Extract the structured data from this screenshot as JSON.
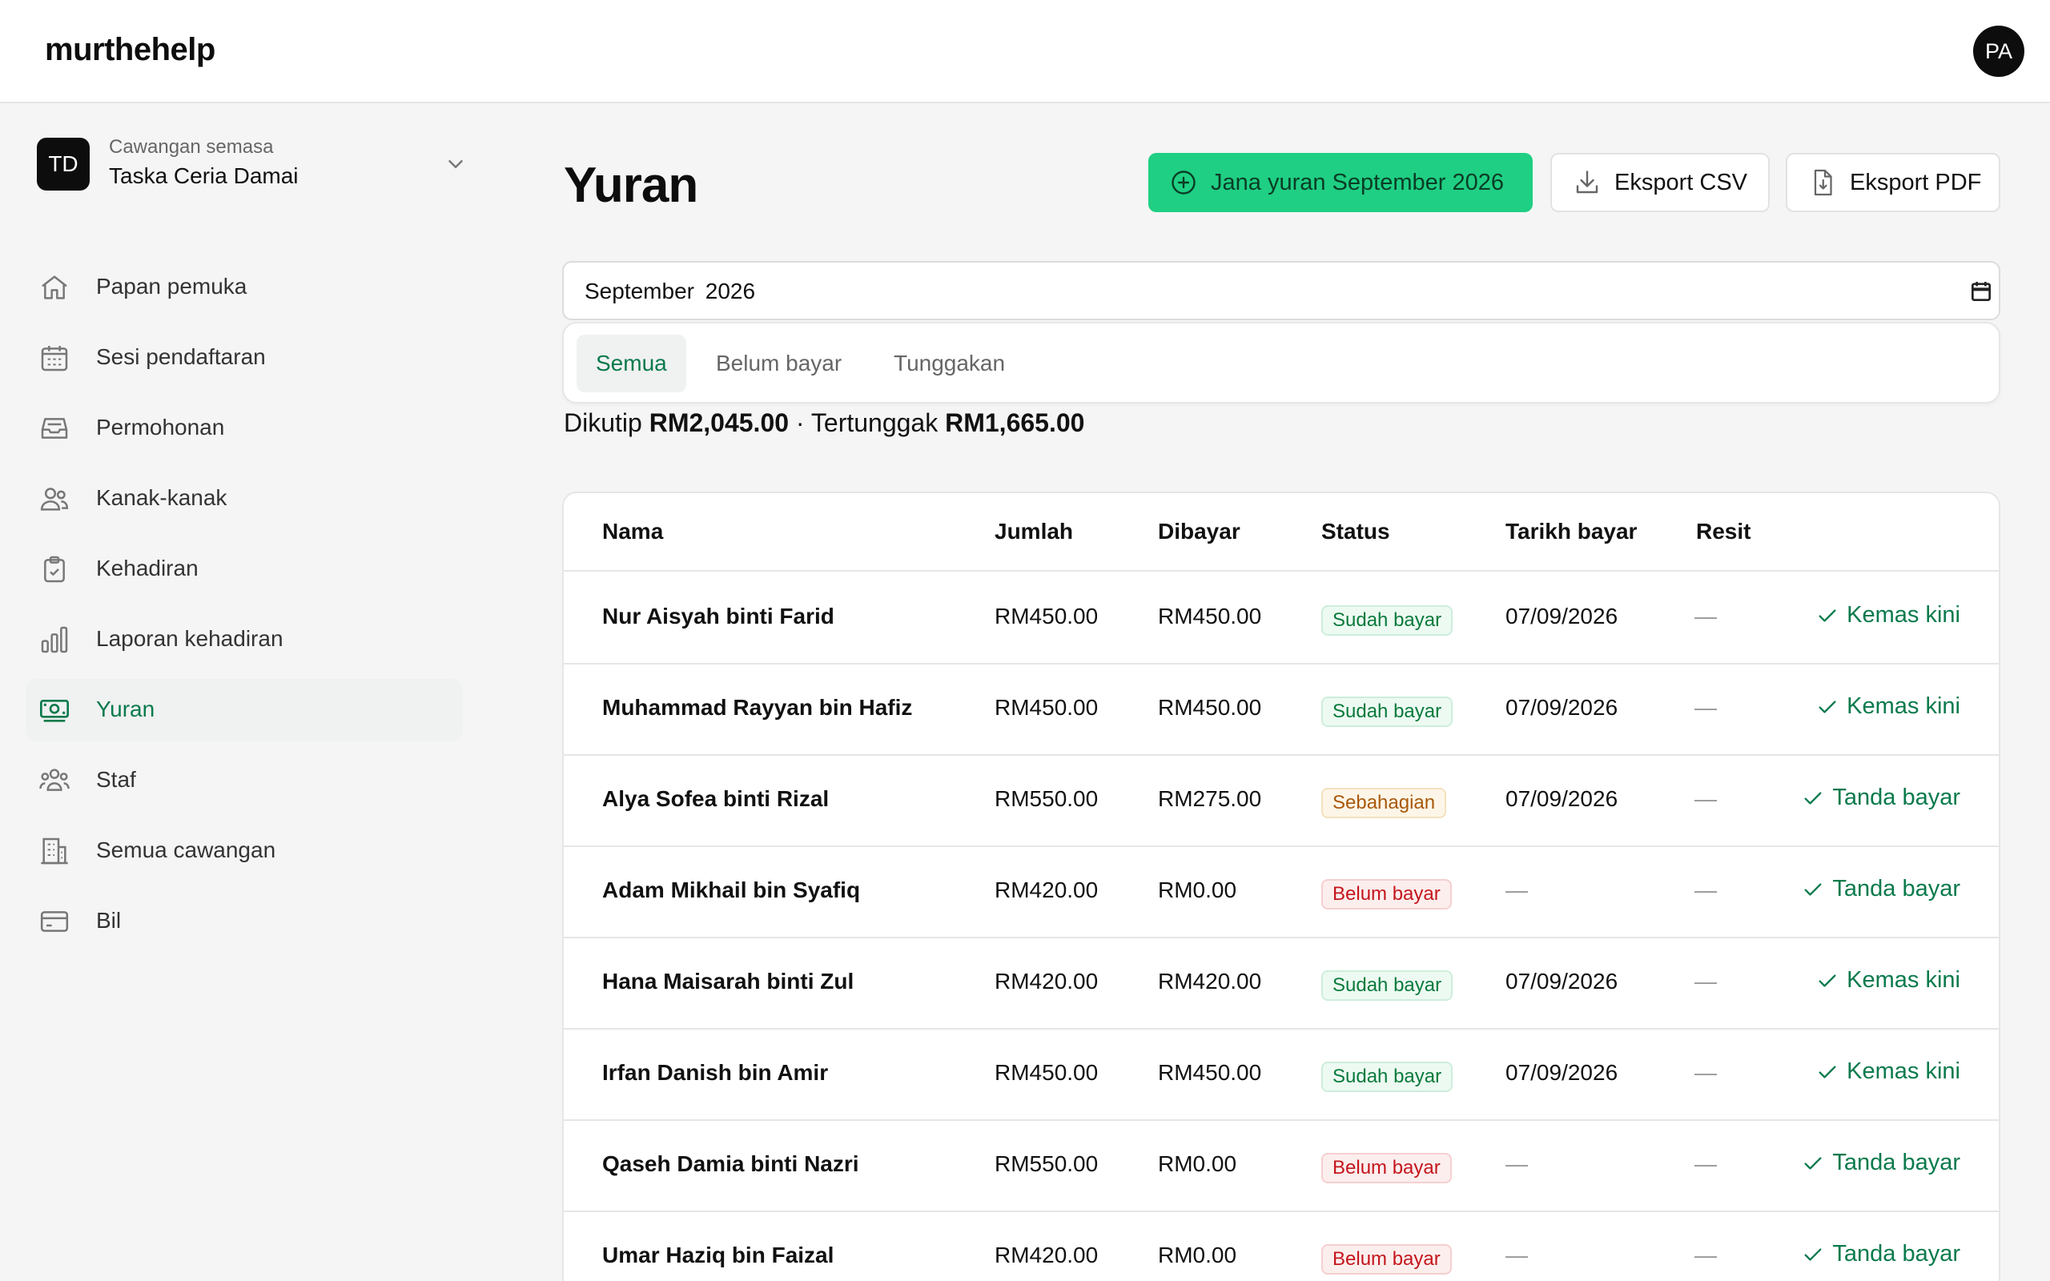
{
  "app": {
    "brand": "murthehelp",
    "avatar_initials": "PA"
  },
  "branch": {
    "badge": "TD",
    "caption": "Cawangan semasa",
    "name": "Taska Ceria Damai"
  },
  "sidebar": {
    "items": [
      {
        "label": "Papan pemuka",
        "icon": "home-icon"
      },
      {
        "label": "Sesi pendaftaran",
        "icon": "calendar-icon"
      },
      {
        "label": "Permohonan",
        "icon": "inbox-icon"
      },
      {
        "label": "Kanak-kanak",
        "icon": "users-icon"
      },
      {
        "label": "Kehadiran",
        "icon": "clipboard-check-icon"
      },
      {
        "label": "Laporan kehadiran",
        "icon": "bar-chart-icon"
      },
      {
        "label": "Yuran",
        "icon": "banknote-icon",
        "active": true
      },
      {
        "label": "Staf",
        "icon": "team-icon"
      },
      {
        "label": "Semua cawangan",
        "icon": "building-icon"
      },
      {
        "label": "Bil",
        "icon": "credit-card-icon"
      }
    ]
  },
  "main": {
    "title": "Yuran",
    "actions": {
      "generate": "Jana yuran September 2026",
      "export_csv": "Eksport CSV",
      "export_pdf": "Eksport PDF"
    },
    "month_value": "September 2026",
    "tabs": [
      "Semua",
      "Belum bayar",
      "Tunggakan"
    ],
    "summary": {
      "collected_label": "Dikutip",
      "collected": "RM2,045.00",
      "separator": "·",
      "outstanding_label": "Tertunggak",
      "outstanding": "RM1,665.00"
    }
  },
  "table": {
    "headers": [
      "Nama",
      "Jumlah",
      "Dibayar",
      "Status",
      "Tarikh bayar",
      "Resit"
    ],
    "rows": [
      {
        "name": "Nur Aisyah binti Farid",
        "amount": "RM450.00",
        "paid": "RM450.00",
        "status": "Sudah bayar",
        "date": "07/09/2026",
        "receipt": "—",
        "action": "Kemas kini"
      },
      {
        "name": "Muhammad Rayyan bin Hafiz",
        "amount": "RM450.00",
        "paid": "RM450.00",
        "status": "Sudah bayar",
        "date": "07/09/2026",
        "receipt": "—",
        "action": "Kemas kini"
      },
      {
        "name": "Alya Sofea binti Rizal",
        "amount": "RM550.00",
        "paid": "RM275.00",
        "status": "Sebahagian",
        "date": "07/09/2026",
        "receipt": "—",
        "action": "Tanda bayar"
      },
      {
        "name": "Adam Mikhail bin Syafiq",
        "amount": "RM420.00",
        "paid": "RM0.00",
        "status": "Belum bayar",
        "date": "—",
        "receipt": "—",
        "action": "Tanda bayar"
      },
      {
        "name": "Hana Maisarah binti Zul",
        "amount": "RM420.00",
        "paid": "RM420.00",
        "status": "Sudah bayar",
        "date": "07/09/2026",
        "receipt": "—",
        "action": "Kemas kini"
      },
      {
        "name": "Irfan Danish bin Amir",
        "amount": "RM450.00",
        "paid": "RM450.00",
        "status": "Sudah bayar",
        "date": "07/09/2026",
        "receipt": "—",
        "action": "Kemas kini"
      },
      {
        "name": "Qaseh Damia binti Nazri",
        "amount": "RM550.00",
        "paid": "RM0.00",
        "status": "Belum bayar",
        "date": "—",
        "receipt": "—",
        "action": "Tanda bayar"
      },
      {
        "name": "Umar Haziq bin Faizal",
        "amount": "RM420.00",
        "paid": "RM0.00",
        "status": "Belum bayar",
        "date": "—",
        "receipt": "—",
        "action": "Tanda bayar"
      }
    ]
  },
  "colors": {
    "accent": "#1fcf83",
    "accent_text": "#0a7a4c",
    "paid": "#0a7a3c",
    "partial": "#a9580a",
    "unpaid": "#c4161c"
  }
}
